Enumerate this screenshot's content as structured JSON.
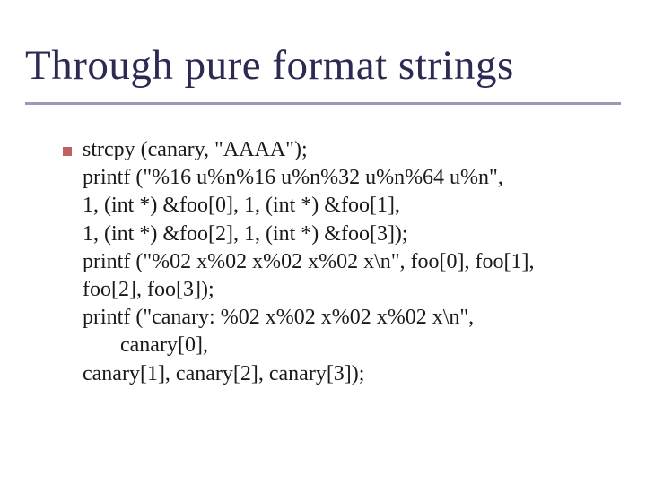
{
  "title": "Through pure format strings",
  "code": {
    "l1": "strcpy (canary, \"AAAA\");",
    "l2": "printf (\"%16 u%n%16 u%n%32 u%n%64 u%n\",",
    "l3": "1, (int *) &foo[0], 1, (int *) &foo[1],",
    "l4": "1, (int *) &foo[2], 1, (int *) &foo[3]);",
    "l5": "printf (\"%02 x%02 x%02 x%02 x\\n\", foo[0], foo[1],",
    "l6": "foo[2], foo[3]);",
    "l7": "printf (\"canary: %02 x%02 x%02 x%02 x\\n\",",
    "l8": "   canary[0],",
    "l9": "canary[1], canary[2], canary[3]);"
  }
}
